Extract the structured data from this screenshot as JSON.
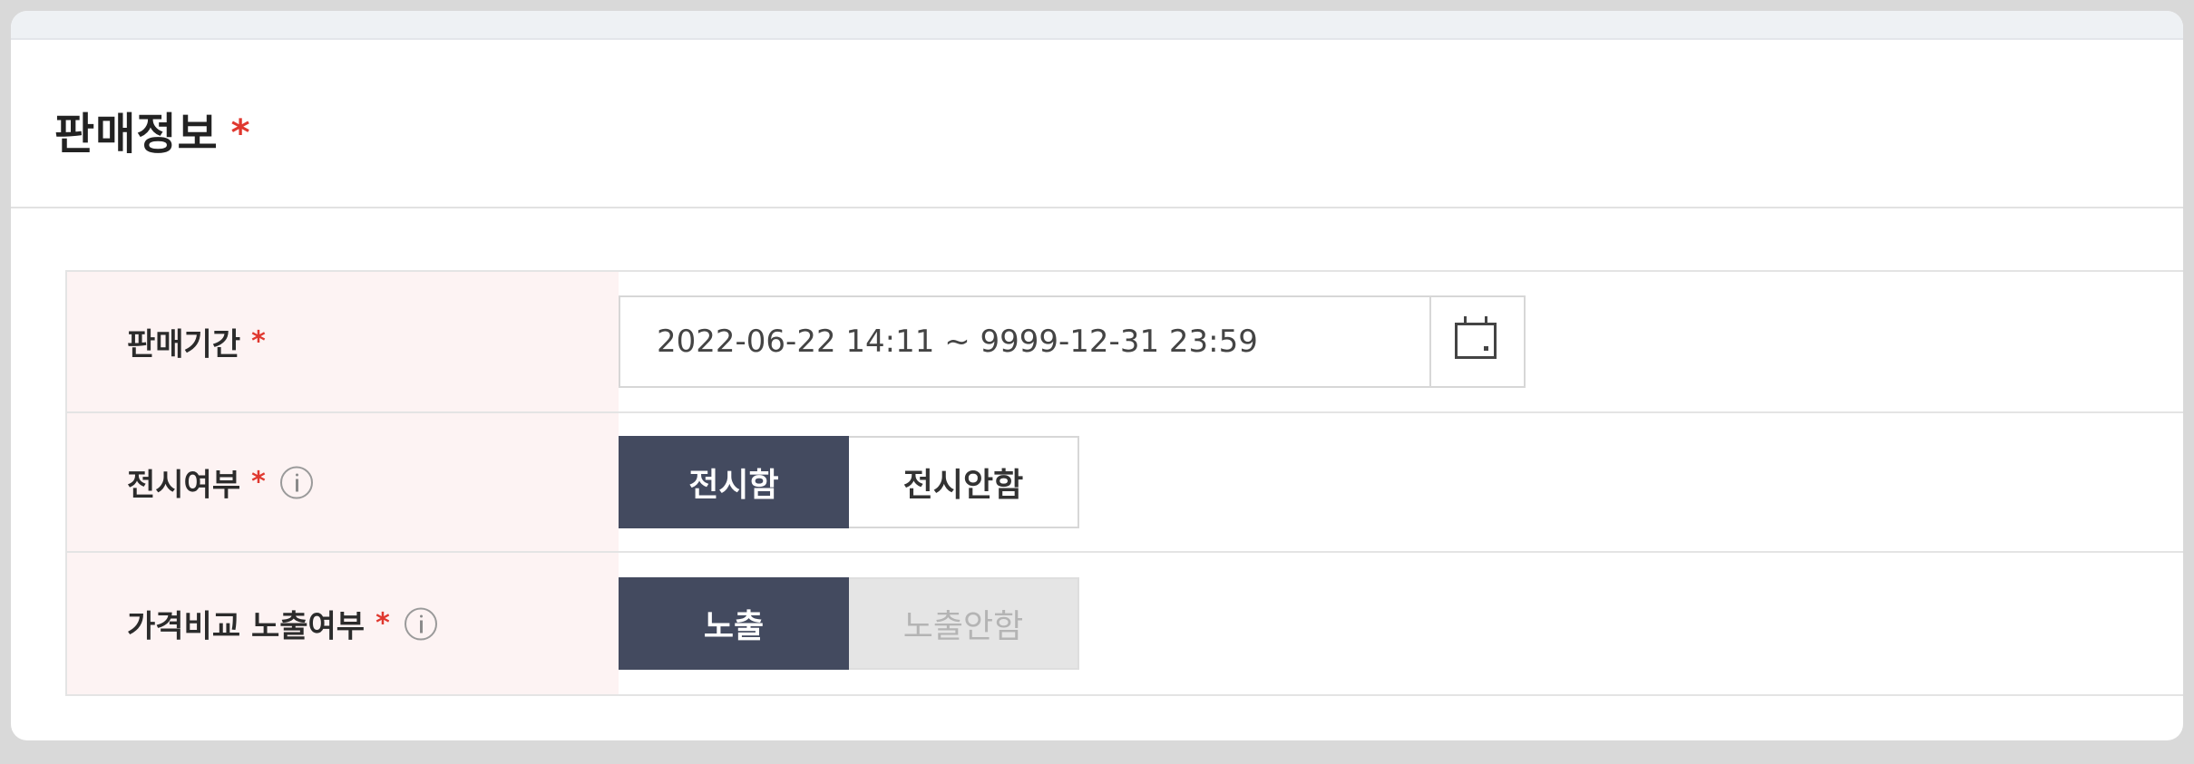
{
  "section": {
    "title": "판매정보",
    "required_mark": "*"
  },
  "rows": [
    {
      "label": "판매기간",
      "required_mark": "*",
      "value": "2022-06-22 14:11 ~ 9999-12-31 23:59",
      "icon": "calendar-icon"
    },
    {
      "label": "전시여부",
      "required_mark": "*",
      "icon": "info-icon",
      "options": [
        "전시함",
        "전시안함"
      ],
      "selected": "전시함"
    },
    {
      "label": "가격비교 노출여부",
      "required_mark": "*",
      "icon": "info-icon",
      "options": [
        "노출",
        "노출안함"
      ],
      "selected": "노출"
    }
  ],
  "colors": {
    "required": "#e0382f",
    "active_toggle": "#434a5f",
    "label_background": "#fdf3f3"
  }
}
